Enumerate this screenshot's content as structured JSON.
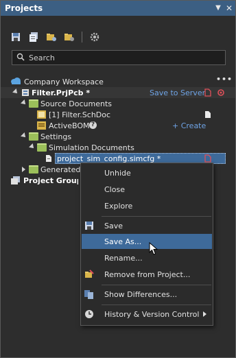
{
  "panel": {
    "title": "Projects"
  },
  "search": {
    "placeholder": "Search"
  },
  "tree": {
    "workspace": "Company Workspace",
    "project": "Filter.PrjPcb *",
    "save_to_server": "Save to Server",
    "source_documents": "Source Documents",
    "schdoc": "[1] Filter.SchDoc",
    "activebom": "ActiveBOM",
    "create": "+ Create",
    "settings": "Settings",
    "simulation_documents": "Simulation Documents",
    "simcfg": "project_sim_config.simcfg *",
    "generated": "Generated",
    "project_group": "Project Group 1"
  },
  "context_menu": {
    "items": [
      {
        "label": "Unhide",
        "mnemonic": "U"
      },
      {
        "label": "Close",
        "mnemonic": "C"
      },
      {
        "label": "Explore",
        "mnemonic": "x"
      },
      {
        "label": "Save",
        "mnemonic": "S"
      },
      {
        "label": "Save As...",
        "mnemonic": "A"
      },
      {
        "label": "Rename...",
        "mnemonic": "R"
      },
      {
        "label": "Remove from Project...",
        "mnemonic": "m"
      },
      {
        "label": "Show Differences...",
        "mnemonic": "S"
      },
      {
        "label": "History & Version Control",
        "mnemonic": "V"
      }
    ],
    "highlighted": "Save As..."
  },
  "colors": {
    "titlebar": "#3c5f83",
    "highlight": "#3e6a9a",
    "folder": "#9bbf5a",
    "link": "#6fa4e6",
    "accent_red": "#e0505a"
  }
}
